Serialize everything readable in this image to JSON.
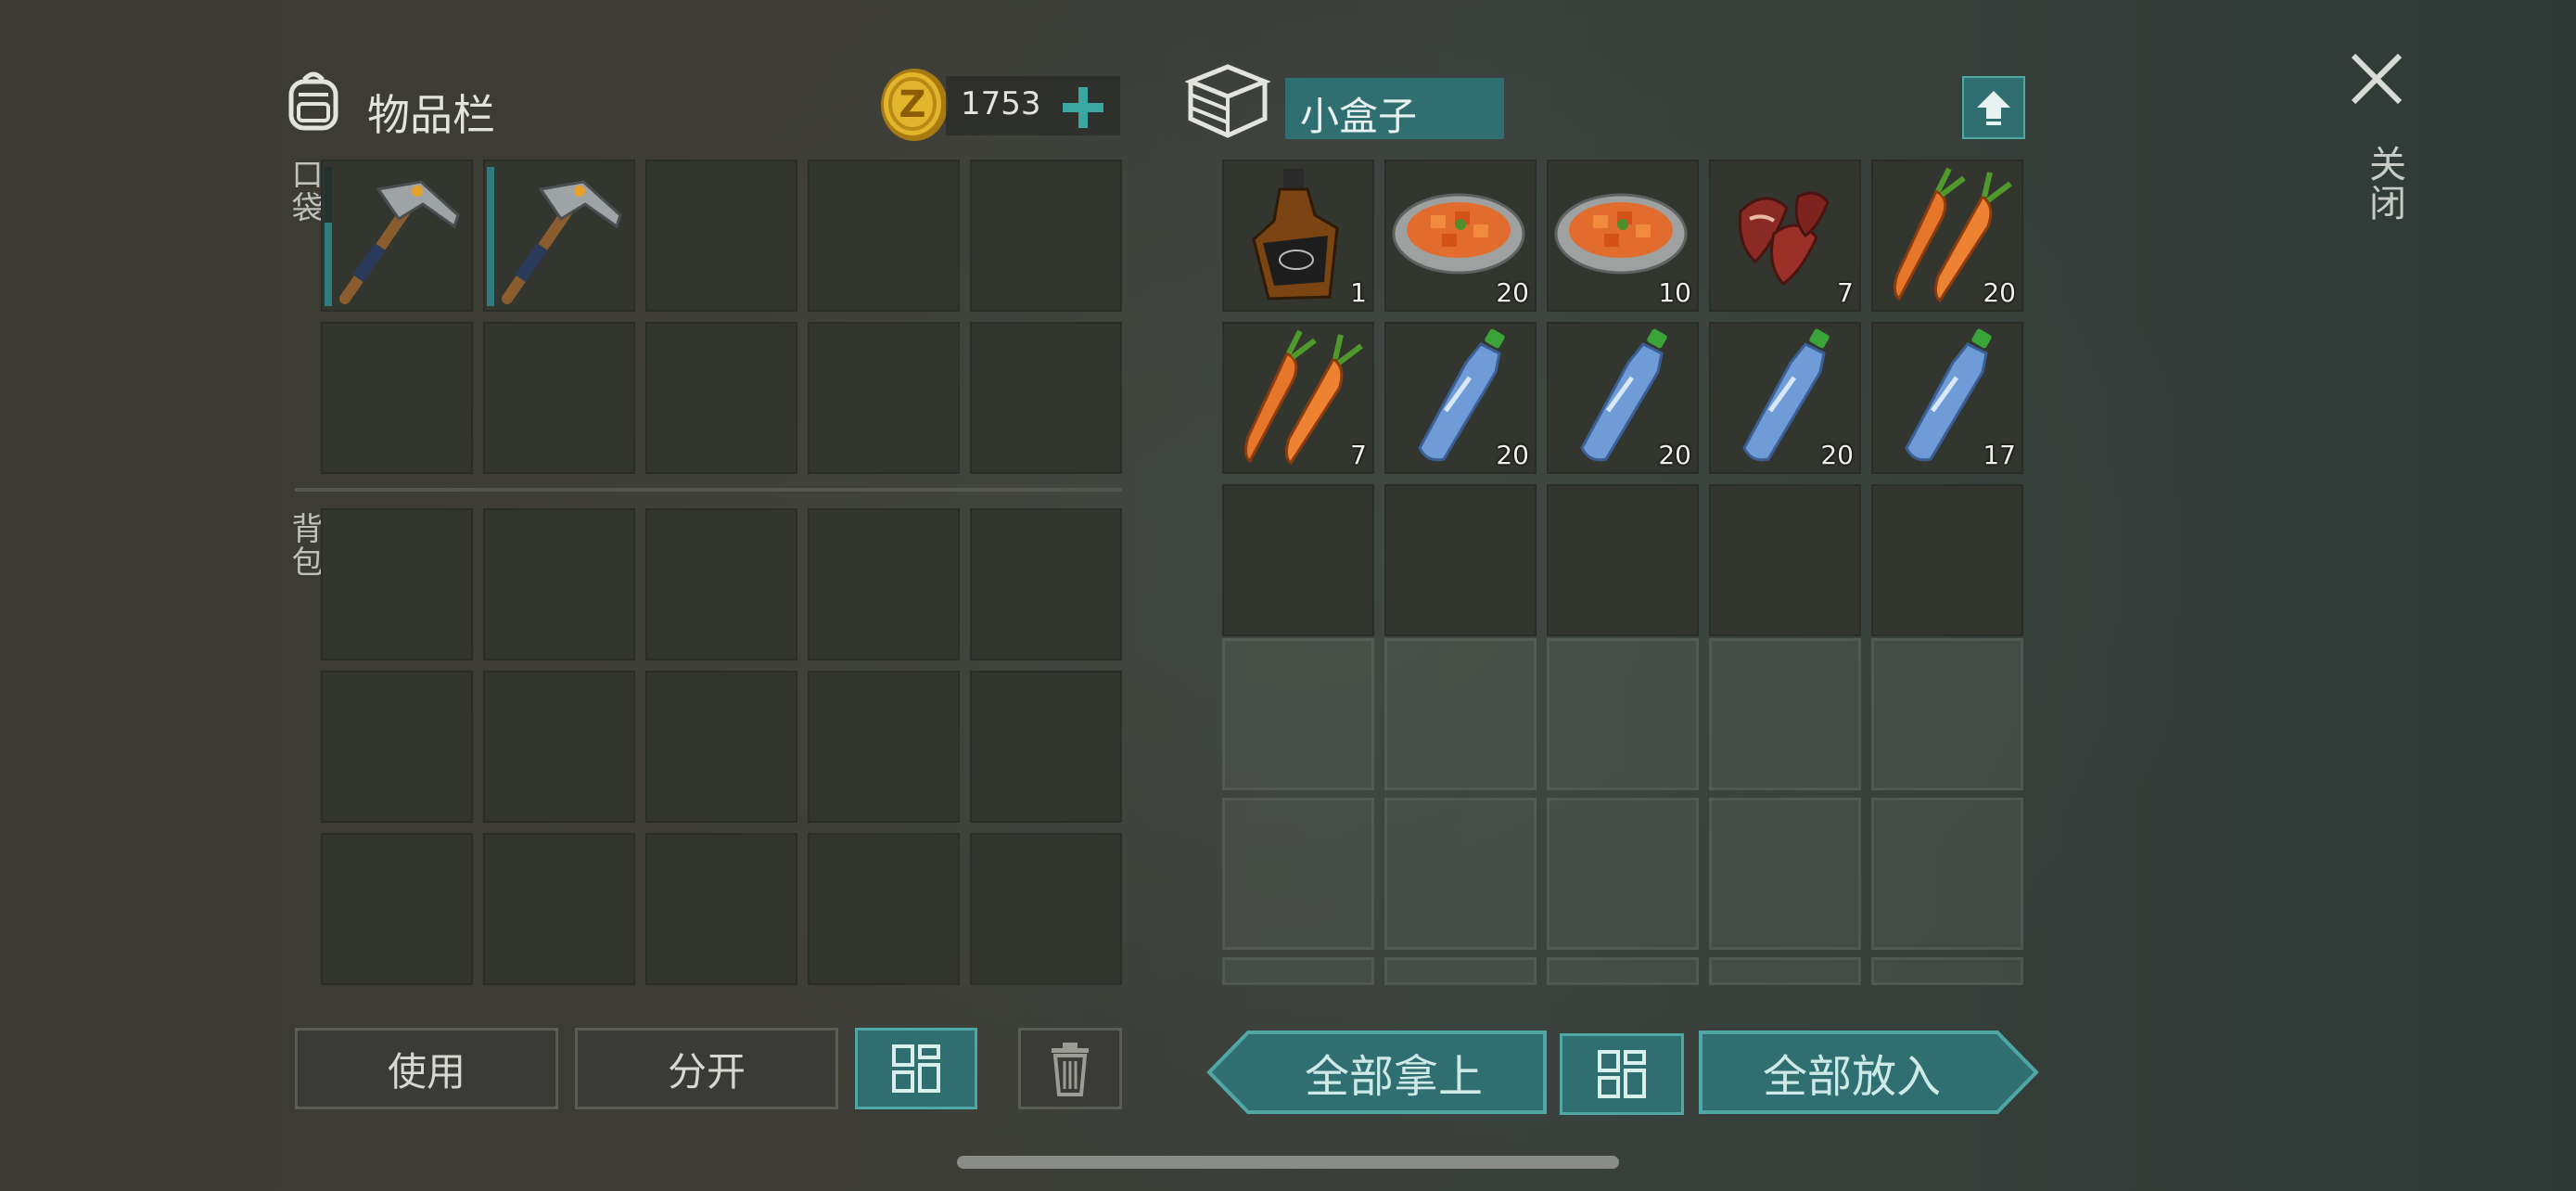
{
  "inventory": {
    "title": "物品栏",
    "coins": "1753",
    "pockets_label": "口袋",
    "backpack_label": "背包"
  },
  "container": {
    "name": "小盒子",
    "items": [
      {
        "name": "whiskey",
        "count": "1"
      },
      {
        "name": "stew",
        "count": "20"
      },
      {
        "name": "stew",
        "count": "10"
      },
      {
        "name": "bacon",
        "count": "7"
      },
      {
        "name": "carrots",
        "count": "20"
      },
      {
        "name": "carrots",
        "count": "7"
      },
      {
        "name": "water-bottle",
        "count": "20"
      },
      {
        "name": "water-bottle",
        "count": "20"
      },
      {
        "name": "water-bottle",
        "count": "20"
      },
      {
        "name": "water-bottle",
        "count": "17"
      }
    ]
  },
  "close": {
    "label": "关闭"
  },
  "buttons": {
    "use": "使用",
    "split": "分开",
    "take_all": "全部拿上",
    "put_all": "全部放入"
  },
  "colors": {
    "accent": "#2f6f72",
    "accent_border": "#4fa7a6",
    "slot": "#33352f"
  },
  "icons": [
    "backpack-icon",
    "coin-icon",
    "plus-icon",
    "box-icon",
    "upload-icon",
    "close-icon",
    "sort-icon",
    "trash-icon",
    "pickaxe-icon",
    "whiskey-icon",
    "stew-icon",
    "bacon-icon",
    "carrot-icon",
    "water-bottle-icon"
  ]
}
